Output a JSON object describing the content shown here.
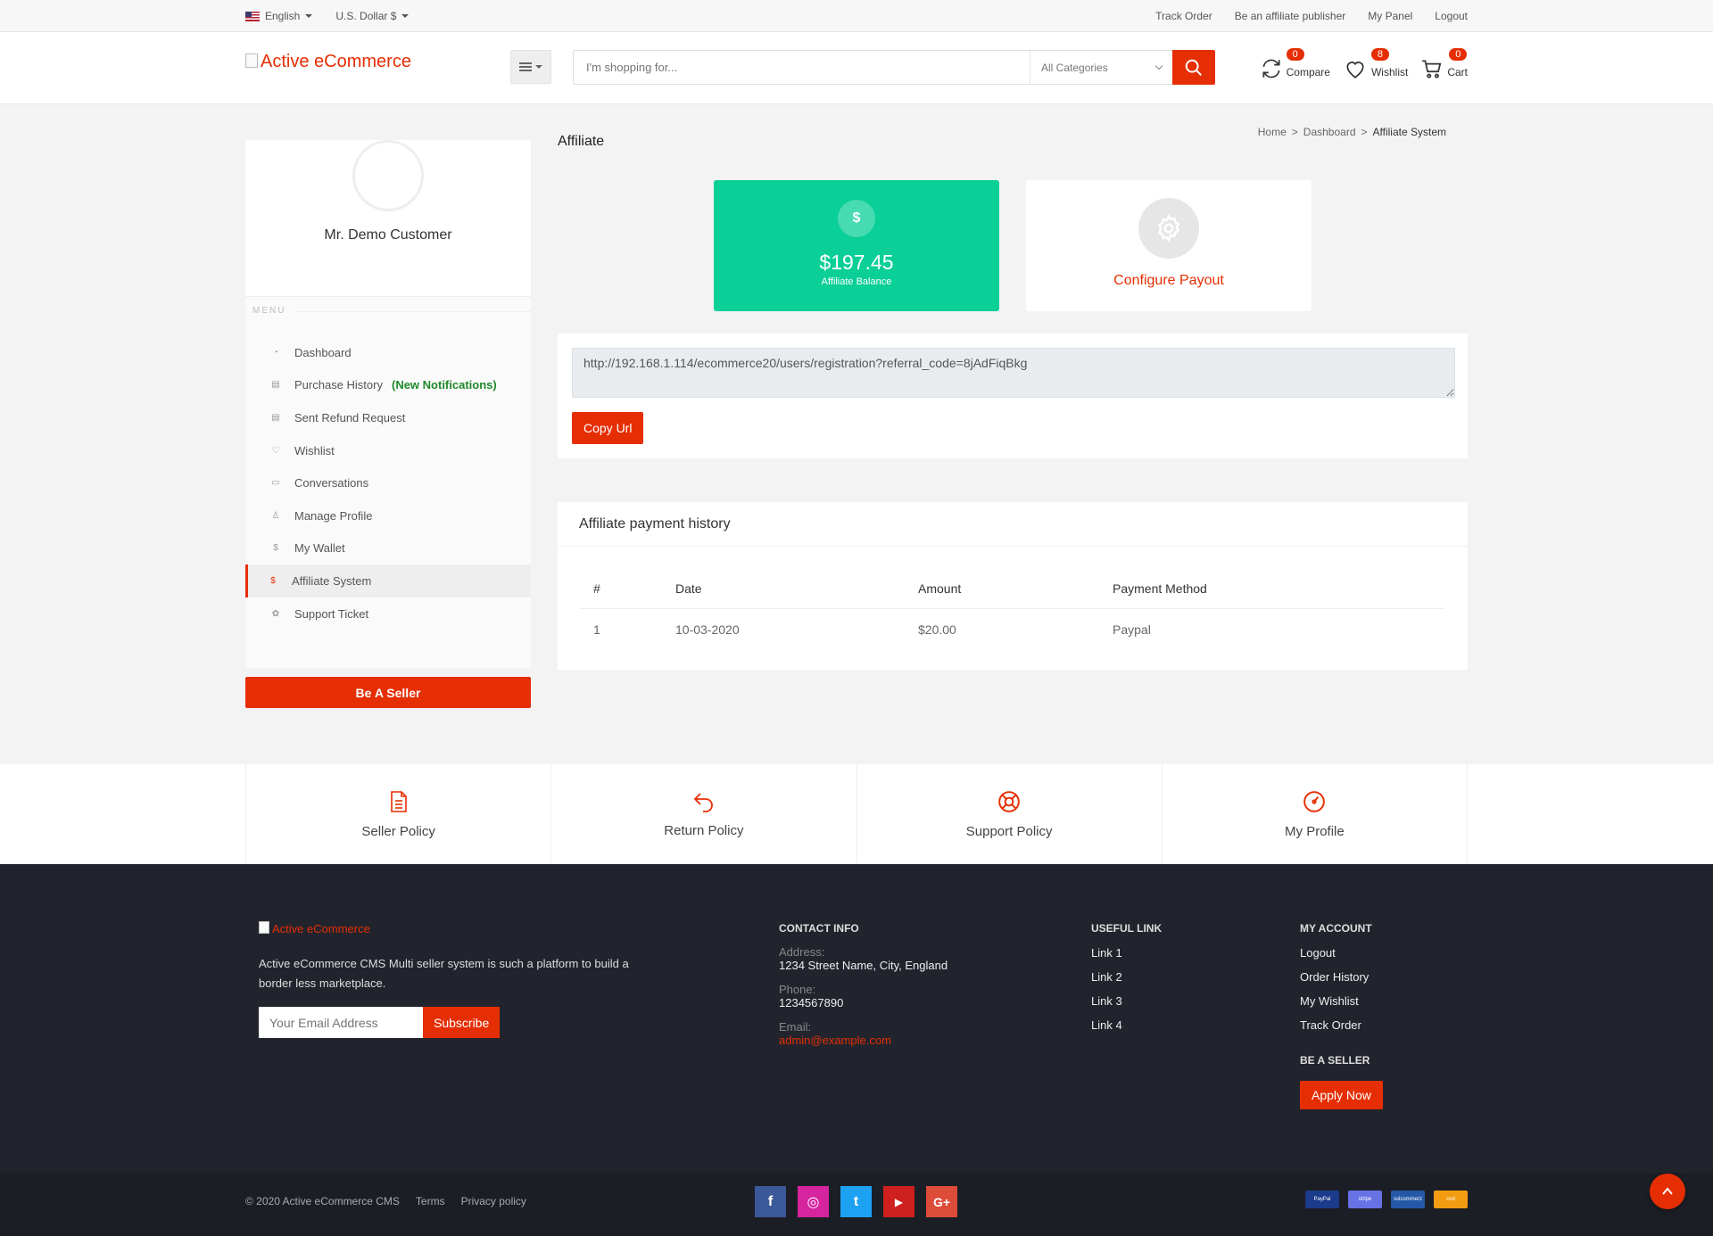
{
  "topbar": {
    "language": "English",
    "currency": "U.S. Dollar $",
    "links": [
      "Track Order",
      "Be an affiliate publisher",
      "My Panel",
      "Logout"
    ]
  },
  "header": {
    "logo_alt": "Active eCommerce",
    "search_placeholder": "I'm shopping for...",
    "category": "All Categories",
    "compare": {
      "label": "Compare",
      "count": "0"
    },
    "wishlist": {
      "label": "Wishlist",
      "count": "8"
    },
    "cart": {
      "label": "Cart",
      "count": "0"
    }
  },
  "sidebar": {
    "user_name": "Mr. Demo Customer",
    "menu_label": "MENU",
    "items": [
      {
        "label": "Dashboard",
        "icon": "dashboard-icon"
      },
      {
        "label": "Purchase History",
        "icon": "file-icon",
        "note": "(New Notifications)"
      },
      {
        "label": "Sent Refund Request",
        "icon": "file-icon"
      },
      {
        "label": "Wishlist",
        "icon": "heart-icon"
      },
      {
        "label": "Conversations",
        "icon": "chat-icon"
      },
      {
        "label": "Manage Profile",
        "icon": "user-icon"
      },
      {
        "label": "My Wallet",
        "icon": "dollar-icon"
      },
      {
        "label": "Affiliate System",
        "icon": "dollar-icon",
        "active": true
      },
      {
        "label": "Support Ticket",
        "icon": "support-icon"
      }
    ],
    "seller_button": "Be A Seller"
  },
  "main": {
    "title": "Affiliate",
    "breadcrumb": [
      "Home",
      ">",
      "Dashboard",
      ">",
      "Affiliate System"
    ],
    "balance": {
      "amount": "$197.45",
      "label": "Affiliate Balance",
      "icon_glyph": "$"
    },
    "payout_label": "Configure Payout",
    "referral_url": "http://192.168.1.114/ecommerce20/users/registration?referral_code=8jAdFiqBkg",
    "copy_button": "Copy Url",
    "history": {
      "title": "Affiliate payment history",
      "columns": [
        "#",
        "Date",
        "Amount",
        "Payment Method"
      ],
      "rows": [
        [
          "1",
          "10-03-2020",
          "$20.00",
          "Paypal"
        ]
      ]
    }
  },
  "policies": [
    {
      "label": "Seller Policy",
      "icon": "document-icon"
    },
    {
      "label": "Return Policy",
      "icon": "return-icon"
    },
    {
      "label": "Support Policy",
      "icon": "lifebuoy-icon"
    },
    {
      "label": "My Profile",
      "icon": "dashboard-icon"
    }
  ],
  "footer": {
    "logo_alt": "Active eCommerce",
    "description": "Active eCommerce CMS Multi seller system is such a platform to build a border less marketplace.",
    "email_placeholder": "Your Email Address",
    "subscribe": "Subscribe",
    "contact": {
      "heading": "CONTACT INFO",
      "address_label": "Address:",
      "address": "1234 Street Name, City, England",
      "phone_label": "Phone:",
      "phone": "1234567890",
      "email_label": "Email:",
      "email": "admin@example.com"
    },
    "useful": {
      "heading": "USEFUL LINK",
      "links": [
        "Link 1",
        "Link 2",
        "Link 3",
        "Link 4"
      ]
    },
    "account": {
      "heading": "MY ACCOUNT",
      "links": [
        "Logout",
        "Order History",
        "My Wishlist",
        "Track Order"
      ]
    },
    "be_seller": {
      "heading": "BE A SELLER",
      "button": "Apply Now"
    },
    "copyright": "© 2020 Active eCommerce CMS",
    "terms": "Terms",
    "privacy": "Privacy policy",
    "social": [
      {
        "icon": "facebook-icon",
        "glyph": "f",
        "color": "#3b5998"
      },
      {
        "icon": "instagram-icon",
        "glyph": "◎",
        "color": "#d6249f"
      },
      {
        "icon": "twitter-icon",
        "glyph": "t",
        "color": "#1da1f2"
      },
      {
        "icon": "youtube-icon",
        "glyph": "▶",
        "color": "#cd201f"
      },
      {
        "icon": "google-plus-icon",
        "glyph": "G+",
        "color": "#dd4b39"
      }
    ],
    "payments": [
      {
        "name": "PayPal",
        "color": "#1b3b8b"
      },
      {
        "name": "stripe",
        "color": "#6772e5"
      },
      {
        "name": "sslcommerz",
        "color": "#2559a8"
      },
      {
        "name": "cod",
        "color": "#f39c12"
      }
    ]
  },
  "colors": {
    "accent": "#e62e04",
    "success": "#0acf97",
    "footer_bg": "#22242d"
  }
}
